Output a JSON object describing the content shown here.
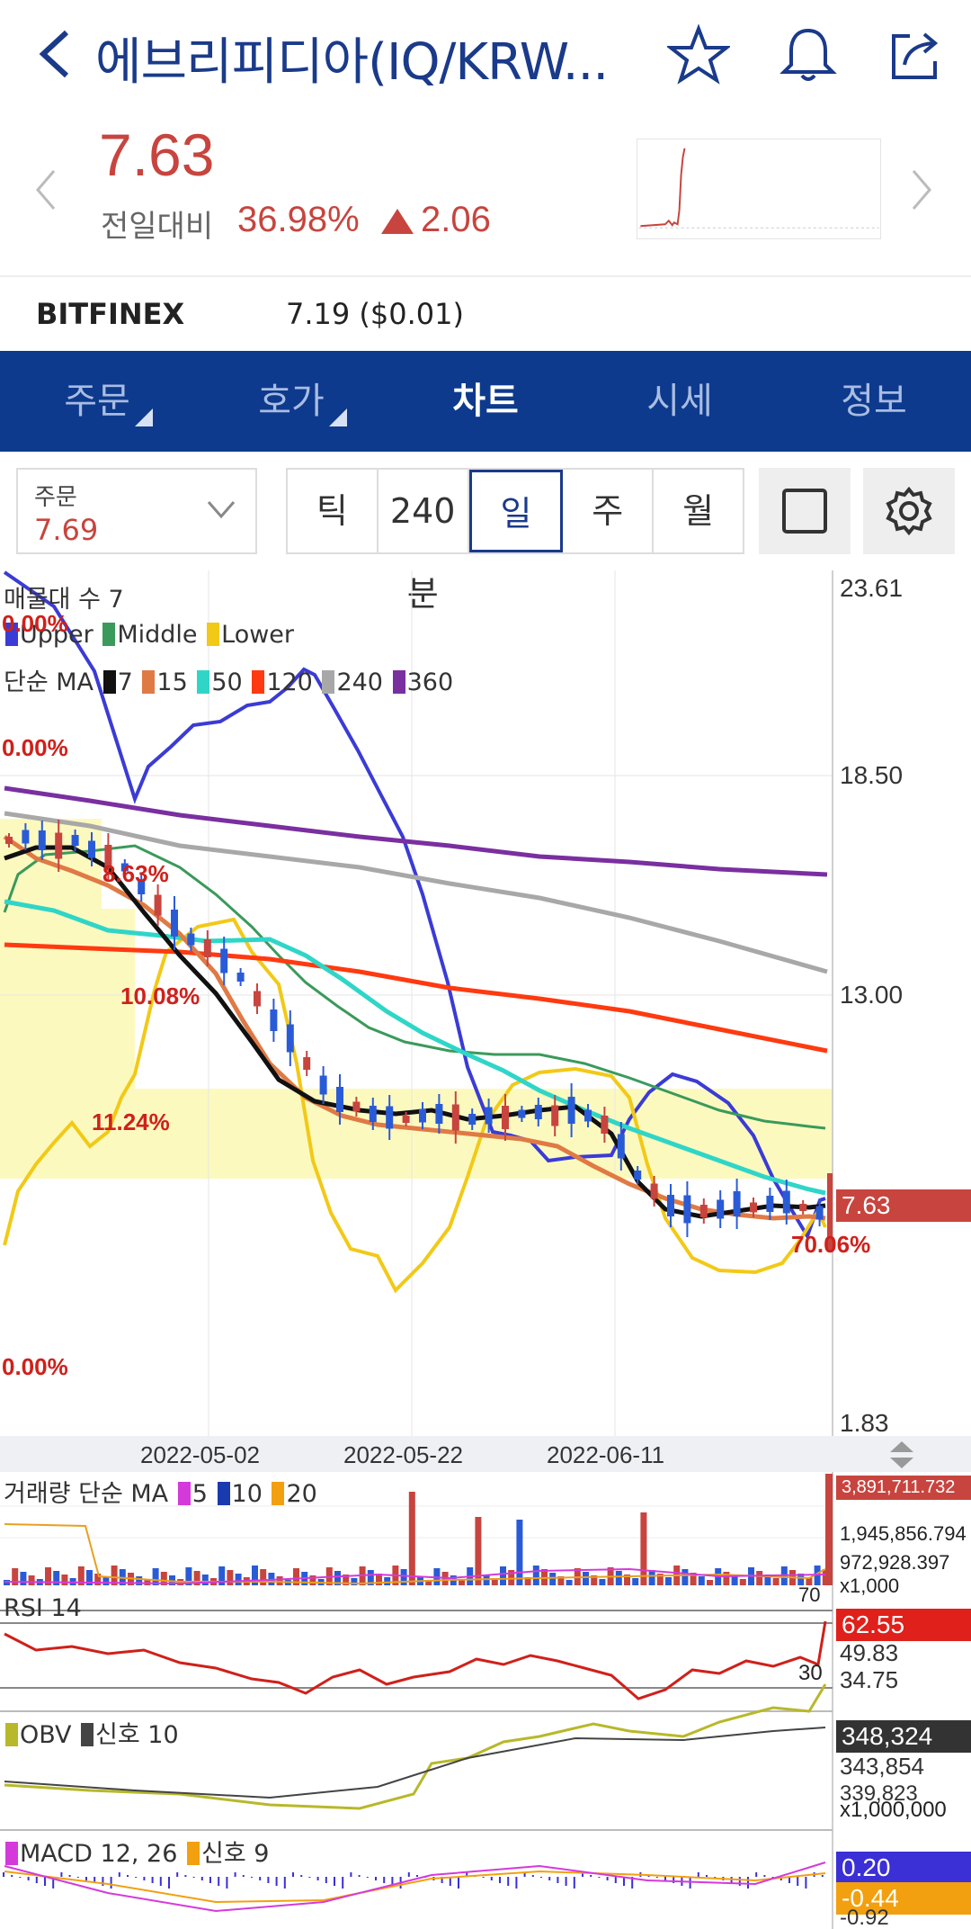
{
  "header": {
    "title": "에브리피디아(IQ/KRW...",
    "icons": [
      "back-icon",
      "star-icon",
      "bell-icon",
      "share-icon"
    ]
  },
  "quote": {
    "price": "7.63",
    "prev_label": "전일대비",
    "change_pct": "36.98%",
    "change_abs": "2.06"
  },
  "exchange": {
    "name": "BITFINEX",
    "value": "7.19 ($0.01)"
  },
  "tabs": [
    {
      "label": "주문"
    },
    {
      "label": "호가"
    },
    {
      "label": "차트"
    },
    {
      "label": "시세"
    },
    {
      "label": "정보"
    }
  ],
  "controls": {
    "order_label": "주문",
    "order_value": "7.69",
    "periods": [
      "틱",
      "240분",
      "일",
      "주",
      "월"
    ]
  },
  "legend": {
    "volume_profile": "매물대 수 7",
    "bb": [
      "Upper",
      "Middle",
      "Lower"
    ],
    "ma_label": "단순 MA",
    "ma_periods": [
      "7",
      "15",
      "50",
      "120",
      "240",
      "360"
    ],
    "vol_label": "거래량 단순 MA",
    "vol_periods": [
      "5",
      "10",
      "20"
    ],
    "rsi_label": "RSI 14",
    "obv_label": "OBV",
    "obv_signal": "신호 10",
    "macd_label": "MACD 12, 26",
    "macd_signal": "신호 9"
  },
  "profile_pcts": [
    "0.00%",
    "0.00%",
    "8.63%",
    "10.08%",
    "11.24%",
    "70.06%",
    "0.00%"
  ],
  "axis": {
    "y": [
      "23.61",
      "18.50",
      "13.00",
      "1.83"
    ],
    "x": [
      "2022-05-02",
      "2022-05-22",
      "2022-06-11"
    ],
    "price_tag": "7.63"
  },
  "volume_axis": [
    "3,891,711.732",
    "1,945,856.794",
    "972,928.397",
    "x1,000",
    "70"
  ],
  "rsi_axis": [
    "62.55",
    "49.83",
    "34.75",
    "30"
  ],
  "obv_axis": [
    "348,324",
    "343,854",
    "339,823",
    "x1,000,000"
  ],
  "macd_axis": [
    "0.20",
    "-0.44",
    "-0.92"
  ],
  "colors": {
    "accent": "#0d3a8c",
    "up": "#c8443e",
    "down": "#2a5bd7",
    "upper": "#3b3bd6",
    "middle": "#3a9a5b",
    "lower": "#f2c916",
    "ma7": "#111111",
    "ma15": "#e07a45",
    "ma50": "#2fd6c8",
    "ma120": "#ff3a10",
    "ma240": "#a8a8a8",
    "ma360": "#7a2fa0"
  }
}
